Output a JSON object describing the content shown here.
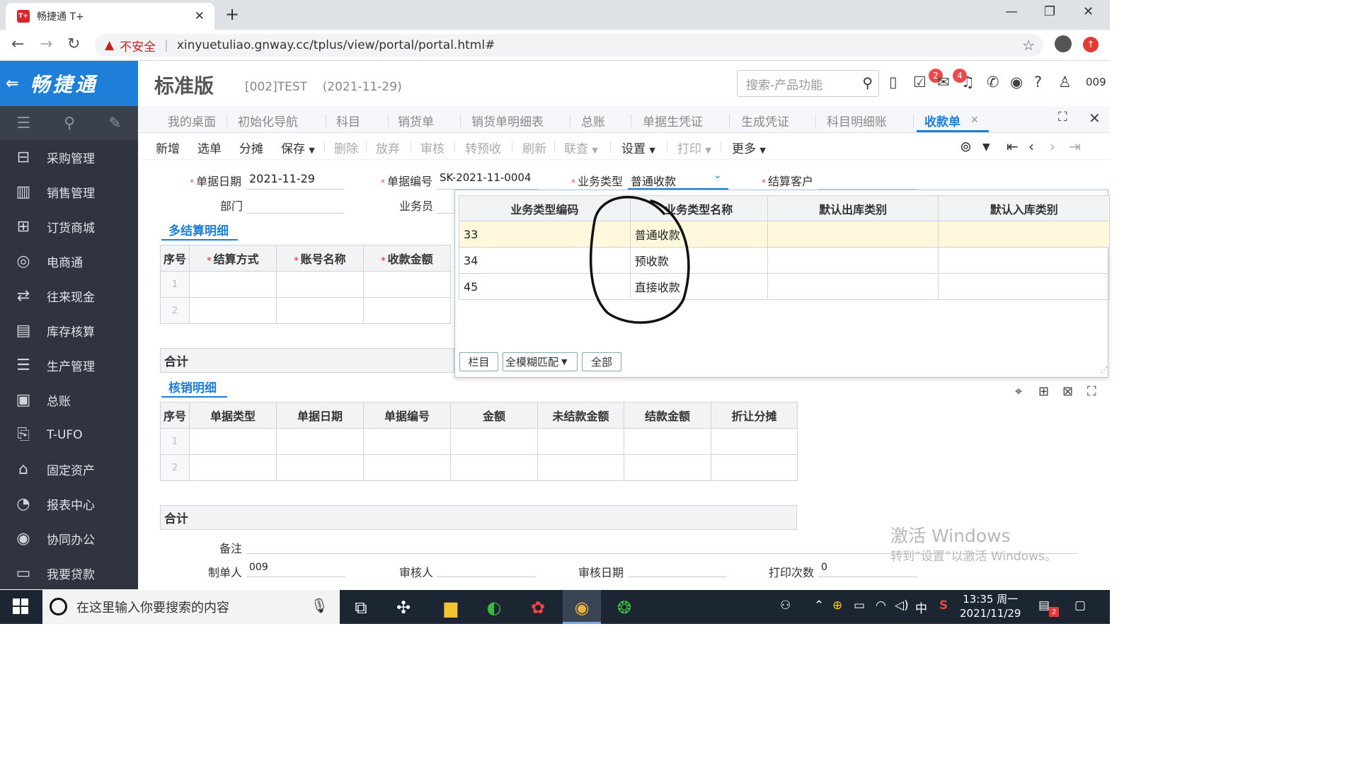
{
  "browser": {
    "tab_title": "畅捷通 T+",
    "tab_favicon": "T+",
    "url_warning": "不安全",
    "url": "xinyuetuliao.gnway.cc/tplus/view/portal/portal.html#"
  },
  "app": {
    "logo_text": "畅捷通",
    "edition": "标准版",
    "account": "[002]TEST",
    "date": "(2021-11-29)",
    "search_placeholder": "搜索-产品功能",
    "badge_messages": "2",
    "badge_notices": "4",
    "user_id": "009"
  },
  "sidebar": {
    "items": [
      {
        "label": "采购管理",
        "icon": "purchase-icon"
      },
      {
        "label": "销售管理",
        "icon": "sales-icon"
      },
      {
        "label": "订货商城",
        "icon": "store-icon"
      },
      {
        "label": "电商通",
        "icon": "ecommerce-icon"
      },
      {
        "label": "往来现金",
        "icon": "cash-icon"
      },
      {
        "label": "库存核算",
        "icon": "inventory-icon"
      },
      {
        "label": "生产管理",
        "icon": "production-icon"
      },
      {
        "label": "总账",
        "icon": "ledger-icon"
      },
      {
        "label": "T-UFO",
        "icon": "ufo-icon"
      },
      {
        "label": "固定资产",
        "icon": "asset-icon"
      },
      {
        "label": "报表中心",
        "icon": "report-icon"
      },
      {
        "label": "协同办公",
        "icon": "office-icon"
      },
      {
        "label": "我要贷款",
        "icon": "loan-icon"
      }
    ]
  },
  "tabs": [
    "我的桌面",
    "初始化导航",
    "科目",
    "销货单",
    "销货单明细表",
    "总账",
    "单据生凭证",
    "生成凭证",
    "科目明细账",
    "收款单"
  ],
  "toolbar": {
    "new": "新增",
    "select": "选单",
    "split": "分摊",
    "save": "保存",
    "delete": "删除",
    "discard": "放弃",
    "audit": "审核",
    "to_prepay": "转预收",
    "refresh": "刷新",
    "query": "联查",
    "settings": "设置",
    "print": "打印",
    "more": "更多"
  },
  "form": {
    "date_label": "单据日期",
    "date_value": "2021-11-29",
    "code_label": "单据编号",
    "code_value": "SK-2021-11-0004",
    "type_label": "业务类型",
    "type_value": "普通收款",
    "customer_label": "结算客户",
    "dept_label": "部门",
    "staff_label": "业务员",
    "remark_label": "备注",
    "maker_label": "制单人",
    "maker_value": "009",
    "auditor_label": "审核人",
    "audit_date_label": "审核日期",
    "print_count_label": "打印次数",
    "print_count_value": "0"
  },
  "settlement": {
    "title": "多结算明细",
    "headers": [
      "序号",
      "结算方式",
      "账号名称",
      "收款金额"
    ],
    "rows": [
      "1",
      "2"
    ],
    "total_label": "合计"
  },
  "writeoff": {
    "title": "核销明细",
    "headers": [
      "序号",
      "单据类型",
      "单据日期",
      "单据编号",
      "金额",
      "未结款金额",
      "结款金额",
      "折让分摊"
    ],
    "rows": [
      "1",
      "2"
    ],
    "total_label": "合计"
  },
  "popup": {
    "headers": [
      "业务类型编码",
      "业务类型名称",
      "默认出库类别",
      "默认入库类别"
    ],
    "rows": [
      {
        "code": "33",
        "name": "普通收款"
      },
      {
        "code": "34",
        "name": "预收款"
      },
      {
        "code": "45",
        "name": "直接收款"
      }
    ],
    "btn_columns": "栏目",
    "match_mode": "全模糊匹配",
    "btn_all": "全部"
  },
  "watermark": {
    "line1": "激活 Windows",
    "line2": "转到“设置”以激活 Windows。"
  },
  "taskbar": {
    "search_placeholder": "在这里输入你要搜索的内容",
    "ime": "中",
    "time": "13:35 周一",
    "date": "2021/11/29",
    "notif_count": "2"
  }
}
